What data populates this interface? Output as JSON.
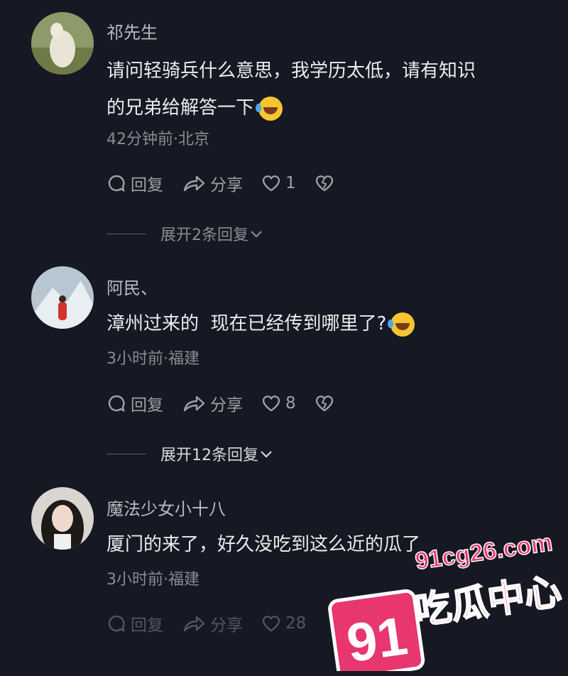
{
  "comments": [
    {
      "username": "祁先生",
      "text_line1": "请问轻骑兵什么意思，我学历太低，请有知识",
      "text_line2": "的兄弟给解答一下",
      "meta": "42分钟前·北京",
      "reply_label": "回复",
      "share_label": "分享",
      "like_count": "1",
      "expand_label": "展开2条回复",
      "emoji": "laughing-tears"
    },
    {
      "username": "阿民、",
      "text_line1": "漳州过来的  现在已经传到哪里了?",
      "meta": "3小时前·福建",
      "reply_label": "回复",
      "share_label": "分享",
      "like_count": "8",
      "expand_label": "展开12条回复",
      "emoji": "laughing-tears"
    },
    {
      "username": "魔法少女小十八",
      "text_line1": "厦门的来了，好久没吃到这么近的瓜了",
      "meta": "3小时前·福建",
      "reply_label": "回复",
      "share_label": "分享",
      "like_count": "28"
    }
  ],
  "watermark": {
    "number": "91",
    "domain": "91cg26.com",
    "brand": "吃瓜中心"
  },
  "colors": {
    "background": "#161823",
    "watermark_pink": "#e8366e"
  }
}
